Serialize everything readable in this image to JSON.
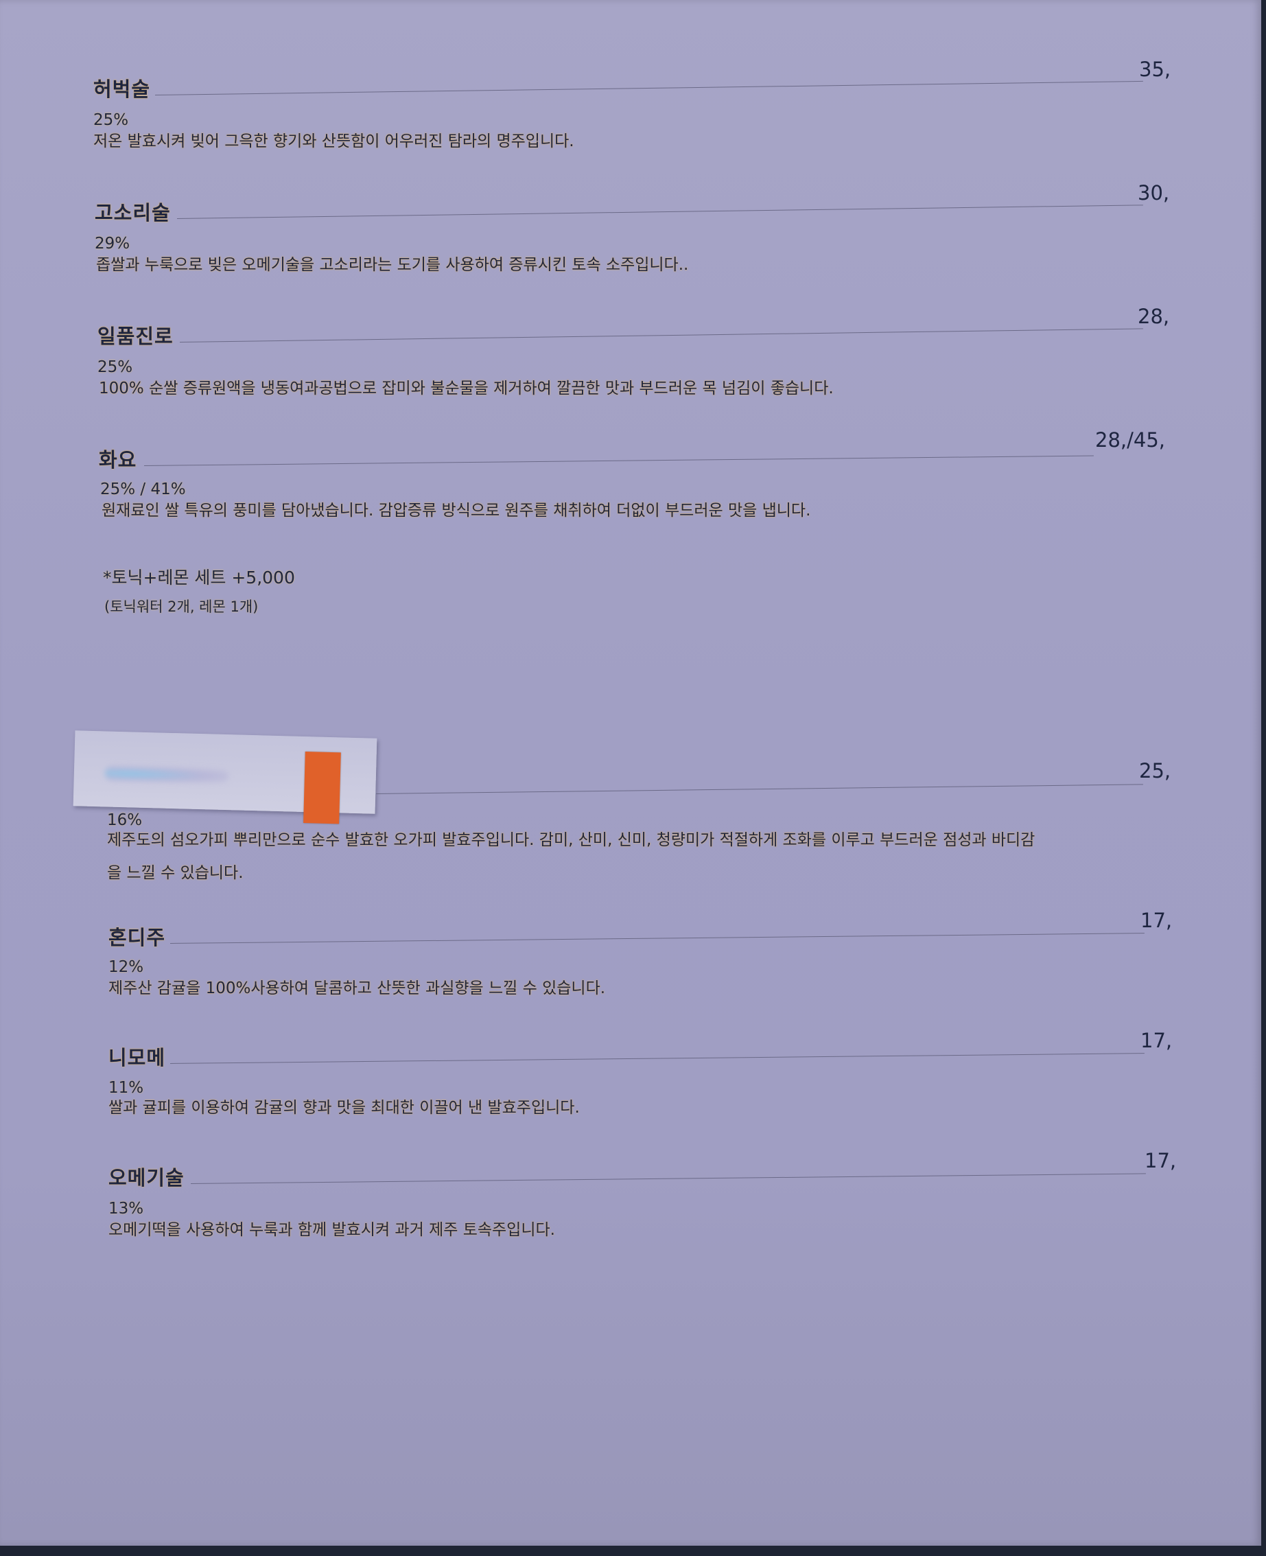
{
  "menu": {
    "items": [
      {
        "name": "허벅술",
        "price": "35,",
        "abv": "25%",
        "desc": [
          "저온 발효시켜 빚어 그윽한 향기와 산뜻함이 어우러진 탐라의 명주입니다."
        ]
      },
      {
        "name": "고소리술",
        "price": "30,",
        "abv": "29%",
        "desc": [
          "좁쌀과 누룩으로 빚은 오메기술을 고소리라는 도기를 사용하여 증류시킨 토속 소주입니다.."
        ]
      },
      {
        "name": "일품진로",
        "price": "28,",
        "abv": "25%",
        "desc": [
          "100% 순쌀 증류원액을 냉동여과공법으로 잡미와 불순물을 제거하여 깔끔한 맛과 부드러운 목 넘김이 좋습니다."
        ]
      },
      {
        "name": "화요",
        "price": "28,/45,",
        "abv": "25% / 41%",
        "desc": [
          "원재료인 쌀 특유의 풍미를 담아냈습니다. 감압증류 방식으로 원주를 채취하여 더없이 부드러운 맛을 냅니다."
        ]
      },
      {
        "name": "",
        "price": "25,",
        "abv": "16%",
        "desc": [
          "제주도의 섬오가피 뿌리만으로 순수 발효한 오가피 발효주입니다. 감미, 산미, 신미, 청량미가 적절하게 조화를 이루고 부드러운 점성과 바디감",
          "을 느낄 수 있습니다."
        ]
      },
      {
        "name": "혼디주",
        "price": "17,",
        "abv": "12%",
        "desc": [
          "제주산 감귤을 100%사용하여 달콤하고 산뜻한 과실향을 느낄 수 있습니다."
        ]
      },
      {
        "name": "니모메",
        "price": "17,",
        "abv": "11%",
        "desc": [
          "쌀과 귤피를 이용하여 감귤의 향과 맛을 최대한 이끌어 낸 발효주입니다."
        ]
      },
      {
        "name": "오메기술",
        "price": "17,",
        "abv": "13%",
        "desc": [
          "오메기떡을 사용하여 누룩과 함께 발효시켜 과거 제주 토속주입니다."
        ]
      }
    ],
    "addon": {
      "title": "*토닉+레몬 세트 +5,000",
      "detail": "(토닉워터 2개, 레몬 1개)"
    }
  },
  "colors": {
    "paper": "#a3a1c5",
    "ink": "#1e2540",
    "sticker_tab": "#e0612a"
  }
}
